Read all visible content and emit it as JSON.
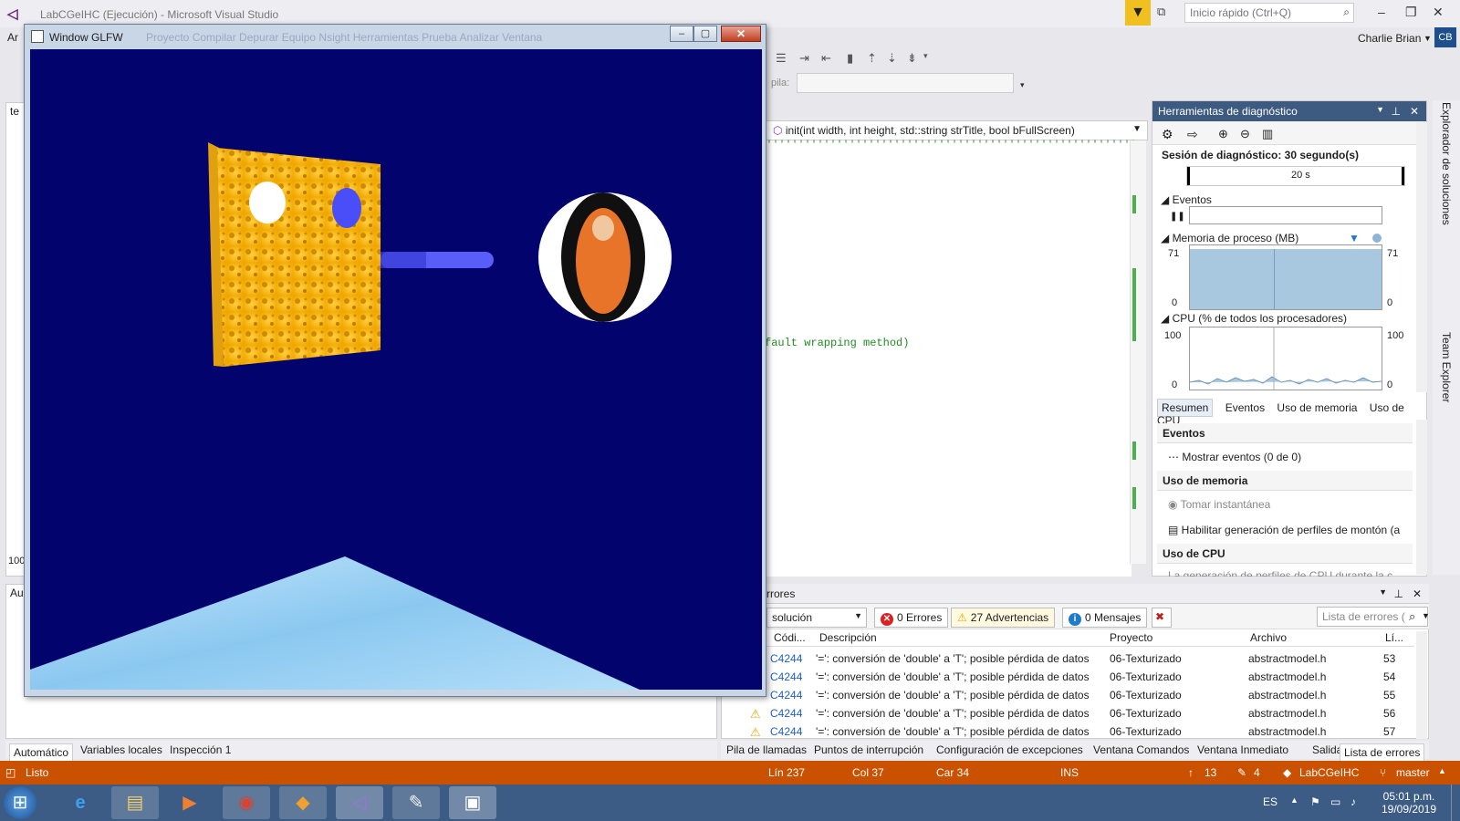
{
  "app": {
    "title": "LabCGeIHC (Ejecución) - Microsoft Visual Studio",
    "quick_launch_placeholder": "Inicio rápido (Ctrl+Q)",
    "user_name": "Charlie Brian",
    "user_initials": "CB",
    "menu_partial": "Ar"
  },
  "glfw": {
    "title": "Window GLFW",
    "ghost_menu": "Proyecto   Compilar   Depurar   Equipo   Nsight   Herramientas   Prueba   Analizar   Ventana"
  },
  "toolbar": {
    "pila_label": "pila:"
  },
  "editor": {
    "nav_function": "init(int width, int height, std::string strTitle, bool bFullScreen)",
    "code_visible": "fault wrapping method)",
    "left_tab_fragment": "te",
    "left_number": "100",
    "left_au": "Au"
  },
  "diagnostics": {
    "title": "Herramientas de diagnóstico",
    "session": "Sesión de diagnóstico: 30 segundo(s)",
    "timeline_label": "20 s",
    "events_label": "Eventos",
    "memory_label": "Memoria de proceso (MB)",
    "memory_max": "71",
    "memory_min": "0",
    "cpu_label": "CPU (% de todos los procesadores)",
    "cpu_max": "100",
    "cpu_min": "0",
    "tabs": [
      "Resumen",
      "Eventos",
      "Uso de memoria",
      "Uso de CPU"
    ],
    "group_events": "Eventos",
    "show_events": "Mostrar eventos (0 de 0)",
    "group_memory": "Uso de memoria",
    "snapshot": "Tomar instantánea",
    "heap_profile": "Habilitar generación de perfiles de montón (a",
    "group_cpu": "Uso de CPU",
    "cpu_note": "La generación de perfiles de CPU durante la c"
  },
  "side_tabs": [
    "Explorador de soluciones",
    "Team Explorer"
  ],
  "errors": {
    "header": "rrores",
    "scope": "solución",
    "errors_chip": "0 Errores",
    "warnings_chip": "27 Advertencias",
    "messages_chip": "0 Mensajes",
    "search_placeholder": "Lista de errores (",
    "columns": [
      "Códi...",
      "Descripción",
      "Proyecto",
      "Archivo",
      "Lí..."
    ],
    "rows": [
      {
        "code": "C4244",
        "desc": "'=': conversión de 'double' a 'T'; posible pérdida de datos",
        "project": "06-Texturizado",
        "file": "abstractmodel.h",
        "line": "53",
        "warn": false
      },
      {
        "code": "C4244",
        "desc": "'=': conversión de 'double' a 'T'; posible pérdida de datos",
        "project": "06-Texturizado",
        "file": "abstractmodel.h",
        "line": "54",
        "warn": false
      },
      {
        "code": "C4244",
        "desc": "'=': conversión de 'double' a 'T'; posible pérdida de datos",
        "project": "06-Texturizado",
        "file": "abstractmodel.h",
        "line": "55",
        "warn": false
      },
      {
        "code": "C4244",
        "desc": "'=': conversión de 'double' a 'T'; posible pérdida de datos",
        "project": "06-Texturizado",
        "file": "abstractmodel.h",
        "line": "56",
        "warn": true
      },
      {
        "code": "C4244",
        "desc": "'=': conversión de 'double' a 'T'; posible pérdida de datos",
        "project": "06-Texturizado",
        "file": "abstractmodel.h",
        "line": "57",
        "warn": true
      }
    ]
  },
  "bottom_tabs_right": [
    "Pila de llamadas",
    "Puntos de interrupción",
    "Configuración de excepciones",
    "Ventana Comandos",
    "Ventana Inmediato",
    "Salida",
    "Lista de errores"
  ],
  "bottom_tabs_left": [
    "Automático",
    "Variables locales",
    "Inspección 1"
  ],
  "status": {
    "ready": "Listo",
    "line": "Lín 237",
    "col": "Col 37",
    "car": "Car 34",
    "ins": "INS",
    "up_count": "13",
    "edit_count": "4",
    "repo": "LabCGeIHC",
    "branch": "master"
  },
  "taskbar": {
    "lang": "ES",
    "time": "05:01 p.m.",
    "date": "19/09/2019"
  },
  "colors": {
    "status_bar": "#ca5100",
    "gl_background": "#03036e",
    "panel_header": "#3d5a80",
    "taskbar": "#3c5c86"
  }
}
